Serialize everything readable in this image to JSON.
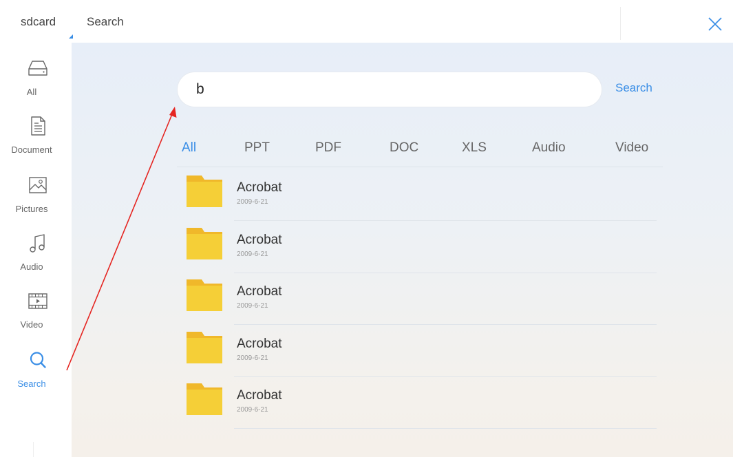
{
  "topbar": {
    "storage_label": "sdcard",
    "tab_label": "Search"
  },
  "sidebar": {
    "items": [
      {
        "label": "All",
        "icon": "drive-icon",
        "active": false
      },
      {
        "label": "Document",
        "icon": "document-icon",
        "active": false
      },
      {
        "label": "Pictures",
        "icon": "picture-icon",
        "active": false
      },
      {
        "label": "Audio",
        "icon": "music-note-icon",
        "active": false
      },
      {
        "label": "Video",
        "icon": "film-icon",
        "active": false
      },
      {
        "label": "Search",
        "icon": "search-icon",
        "active": true
      }
    ]
  },
  "search": {
    "value": "b",
    "button_label": "Search"
  },
  "filters": {
    "tabs": [
      "All",
      "PPT",
      "PDF",
      "DOC",
      "XLS",
      "Audio",
      "Video"
    ],
    "active": "All"
  },
  "results": [
    {
      "name": "Acrobat",
      "date": "2009-6-21"
    },
    {
      "name": "Acrobat",
      "date": "2009-6-21"
    },
    {
      "name": "Acrobat",
      "date": "2009-6-21"
    },
    {
      "name": "Acrobat",
      "date": "2009-6-21"
    },
    {
      "name": "Acrobat",
      "date": "2009-6-21"
    }
  ],
  "colors": {
    "accent": "#3a8ee6",
    "folder": "#f5cf37",
    "folder_tab": "#f0b82a",
    "annotation_arrow": "#e52521"
  }
}
